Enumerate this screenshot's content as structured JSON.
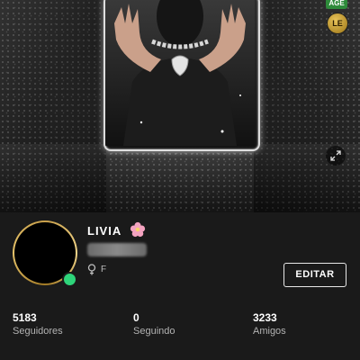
{
  "banner": {
    "age_badge": "AGE",
    "level_badge": "LE",
    "expand_icon": "expand-icon"
  },
  "profile": {
    "name": "LIVIA",
    "name_emoji": "flower-icon",
    "handle_hidden": true,
    "gender_symbol": "♀",
    "gender_label": "F",
    "online_status_color": "#2ed47a",
    "ring_color": "#c9a04a",
    "edit_label": "EDITAR"
  },
  "stats": [
    {
      "value": "5183",
      "label": "Seguidores"
    },
    {
      "value": "0",
      "label": "Seguindo"
    },
    {
      "value": "3233",
      "label": "Amigos"
    }
  ],
  "colors": {
    "background": "#1a1a1a",
    "text_primary": "#ffffff",
    "text_secondary": "#b3b3b3",
    "age_badge": "#2e8b3a",
    "level_badge": "#c9a04a"
  }
}
